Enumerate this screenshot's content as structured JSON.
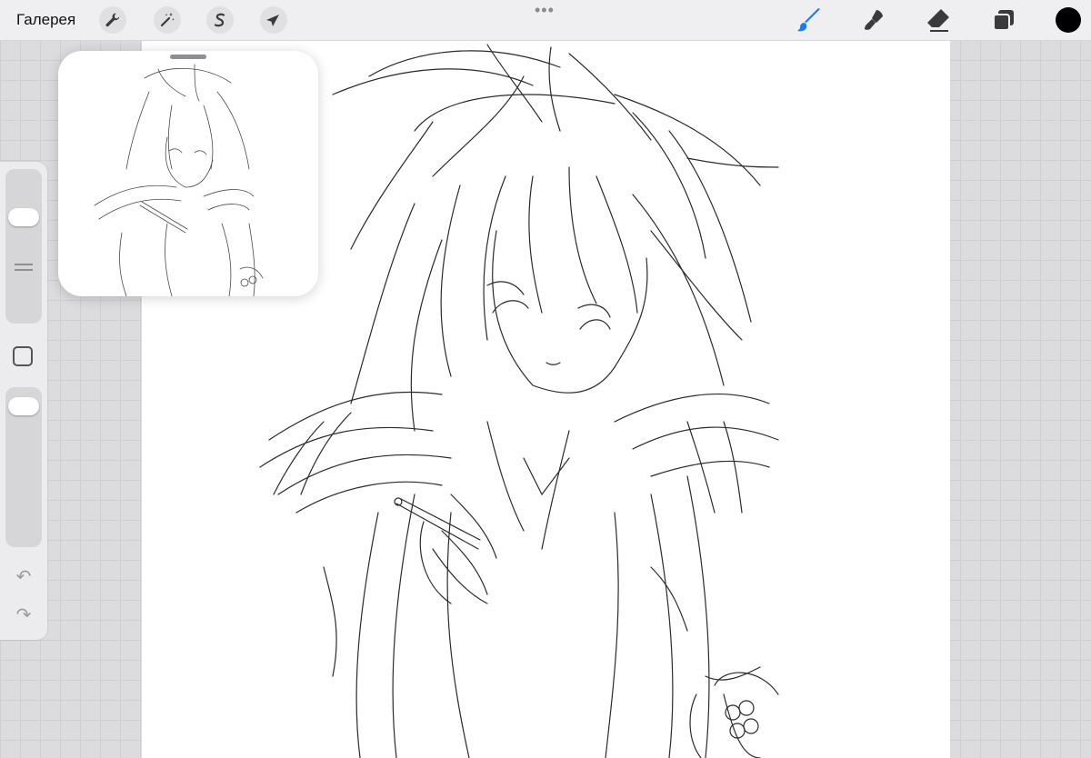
{
  "topbar": {
    "gallery_label": "Галерея",
    "left_tools": [
      {
        "name": "actions",
        "icon": "wrench-icon"
      },
      {
        "name": "adjustments",
        "icon": "magic-wand-icon"
      },
      {
        "name": "selection",
        "icon": "selection-s-icon"
      },
      {
        "name": "transform",
        "icon": "arrow-cursor-icon"
      }
    ],
    "more_icon": "more-dots-icon",
    "right_tools": [
      {
        "name": "brush",
        "icon": "brush-icon",
        "active": true
      },
      {
        "name": "smudge",
        "icon": "smudge-icon",
        "active": false
      },
      {
        "name": "eraser",
        "icon": "eraser-icon",
        "active": false
      },
      {
        "name": "layers",
        "icon": "layers-icon",
        "active": false
      }
    ],
    "current_color": "#000000"
  },
  "sidebar": {
    "brush_size_level": 0.72,
    "opacity_level": 0.95,
    "modify_icon": "square-modify-icon",
    "undo_icon": "undo-arrow-icon",
    "redo_icon": "redo-arrow-icon"
  },
  "colors": {
    "accent": "#1a7cf5",
    "canvas": "#ffffff",
    "workspace": "#dcdcde",
    "stroke": "#2b2b2b"
  },
  "reference_window": {
    "icon": "reference-thumbnail"
  }
}
